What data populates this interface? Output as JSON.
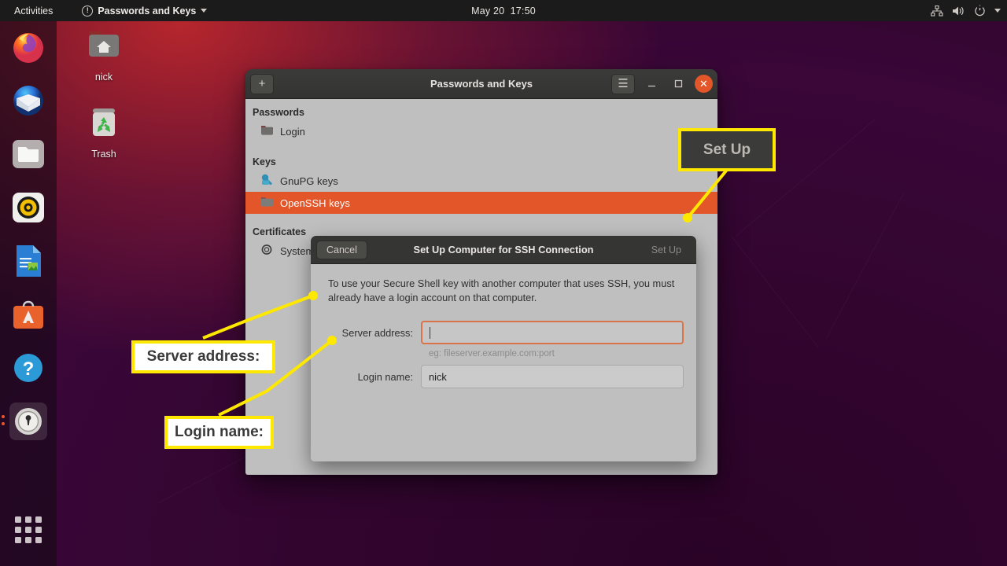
{
  "topbar": {
    "activities": "Activities",
    "app_indicator_icon": "info-circle-icon",
    "app_name": "Passwords and Keys",
    "clock": "May 20  17:50",
    "status_icons": [
      "network-icon",
      "volume-icon",
      "power-icon",
      "chevron-down-icon"
    ]
  },
  "dock": {
    "items": [
      {
        "name": "firefox",
        "label": "Firefox"
      },
      {
        "name": "thunderbird",
        "label": "Thunderbird Mail"
      },
      {
        "name": "files",
        "label": "Files"
      },
      {
        "name": "rhythmbox",
        "label": "Rhythmbox"
      },
      {
        "name": "libreoffice-writer",
        "label": "LibreOffice Writer"
      },
      {
        "name": "ubuntu-software",
        "label": "Ubuntu Software"
      },
      {
        "name": "help",
        "label": "Help"
      },
      {
        "name": "passwords-and-keys",
        "label": "Passwords and Keys"
      }
    ],
    "show_apps_label": "Show Applications"
  },
  "desktop_icons": [
    {
      "name": "home-folder",
      "label": "nick"
    },
    {
      "name": "trash",
      "label": "Trash"
    }
  ],
  "window": {
    "title": "Passwords and Keys",
    "add_button_label": "+",
    "menu_button_label": "☰",
    "minimize_label": "–",
    "maximize_label": "□",
    "close_label": "✕",
    "sidebar": [
      {
        "type": "header",
        "label": "Passwords"
      },
      {
        "type": "item",
        "label": "Login",
        "icon": "keyring-icon",
        "selected": false
      },
      {
        "type": "header",
        "label": "Keys"
      },
      {
        "type": "item",
        "label": "GnuPG keys",
        "icon": "gnupg-key-icon",
        "selected": false
      },
      {
        "type": "item",
        "label": "OpenSSH keys",
        "icon": "keyring-icon",
        "selected": true
      },
      {
        "type": "header",
        "label": "Certificates"
      },
      {
        "type": "item",
        "label": "System Trusted CAs",
        "icon": "certificate-icon",
        "selected": false
      }
    ]
  },
  "dialog": {
    "cancel_label": "Cancel",
    "title": "Set Up Computer for SSH Connection",
    "setup_label": "Set Up",
    "description": "To use your Secure Shell key with another computer that uses SSH, you must already have a login account on that computer.",
    "server_address_label": "Server address:",
    "server_address_value": "",
    "server_address_hint": "eg: fileserver.example.com:port",
    "login_name_label": "Login name:",
    "login_name_value": "nick"
  },
  "annotations": [
    {
      "name": "setup-callout",
      "label": "Set Up",
      "style": "dark"
    },
    {
      "name": "server-address-callout",
      "label": "Server address:",
      "style": "light"
    },
    {
      "name": "login-name-callout",
      "label": "Login name:",
      "style": "light"
    }
  ],
  "colors": {
    "accent_orange": "#e2562a",
    "annotation_yellow": "#ffe800",
    "window_bg": "#bfbfbf",
    "headerbar": "#353533",
    "topbar": "#1b1b1b"
  }
}
